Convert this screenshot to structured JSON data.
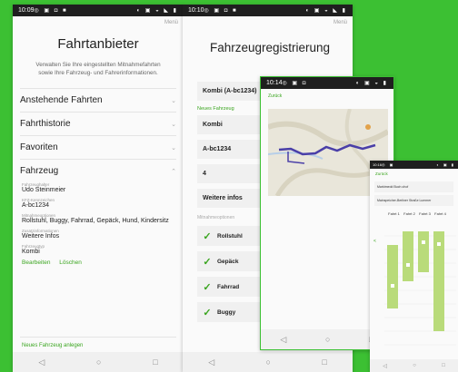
{
  "phone1": {
    "status": {
      "time": "10:09",
      "left_icons": "◎ ▣ ◘ ■",
      "right_icons": "◐ ▣ ◒ ◣ ▮"
    },
    "menu": "Menü",
    "title": "Fahrtanbieter",
    "intro": "Verwalten Sie Ihre eingestellten Mitnahmefahrten sowie Ihre Fahrzeug- und Fahrerinformationen.",
    "sections": [
      {
        "label": "Anstehende Fahrten",
        "chev": "⌄"
      },
      {
        "label": "Fahrthistorie",
        "chev": "⌄"
      },
      {
        "label": "Favoriten",
        "chev": "⌄"
      },
      {
        "label": "Fahrzeug",
        "chev": "⌃"
      }
    ],
    "fields": [
      {
        "label": "Fahrzeughalter",
        "value": "Udo Steinmeier"
      },
      {
        "label": "KFZ-Kennzeichen",
        "value": "A-bc1234"
      },
      {
        "label": "Mitnahmeoptionen",
        "value": "Rollstuhl, Buggy, Fahrrad, Gepäck, Hund, Kindersitz"
      },
      {
        "label": "Zusatzinformationen",
        "value": "Weitere Infos"
      },
      {
        "label": "Fahrzeugtyp",
        "value": "Kombi"
      }
    ],
    "edit": "Bearbeiten",
    "delete": "Löschen",
    "new_vehicle": "Neues Fahrzeug anlegen",
    "nav": [
      "◁",
      "○",
      "□"
    ]
  },
  "phone2": {
    "status": {
      "time": "10:10",
      "left_icons": "◎ ▣ ◘ ■",
      "right_icons": "◐ ▣ ◒ ◣ ▮"
    },
    "menu": "Menü",
    "title": "Fahrzeugregistrierung",
    "rows_top": [
      "Kombi (A-bc1234)"
    ],
    "section_new": "Neues Fahrzeug",
    "rows": [
      "Kombi",
      "A-bc1234",
      "4",
      "Weitere infos"
    ],
    "section_options": "Mitnahmeoptionen",
    "options": [
      "Rollstuhl",
      "Gepäck",
      "Fahrrad",
      "Buggy"
    ],
    "tick": "✓",
    "nav": [
      "◁",
      "○",
      "□"
    ]
  },
  "phone3": {
    "status": {
      "time": "10:14",
      "left_icons": "◎ ▣ ◘",
      "right_icons": "◐ ▣ ◒ ▮"
    },
    "back": "Zurück",
    "nav": [
      "◁",
      "○",
      "□"
    ],
    "colors": {
      "route": "#4a3fa8",
      "map_bg": "#e9e6da",
      "water": "#b7cfe8"
    }
  },
  "phone4": {
    "status": {
      "time": "10:16",
      "left_icons": "◎ ▣",
      "right_icons": "◐ ▣ ▮"
    },
    "back": "Zurück",
    "inputs": [
      "Marktmedd Buch ohof",
      "Mainspeicher-Berliner Straße Lummer"
    ],
    "columns": [
      "Fahrt 1",
      "Fahrt 2",
      "Fahrt 3",
      "Fahrt 4"
    ],
    "nav": [
      "◁",
      "○",
      "□"
    ],
    "colors": {
      "bar": "#b9db7a"
    }
  }
}
